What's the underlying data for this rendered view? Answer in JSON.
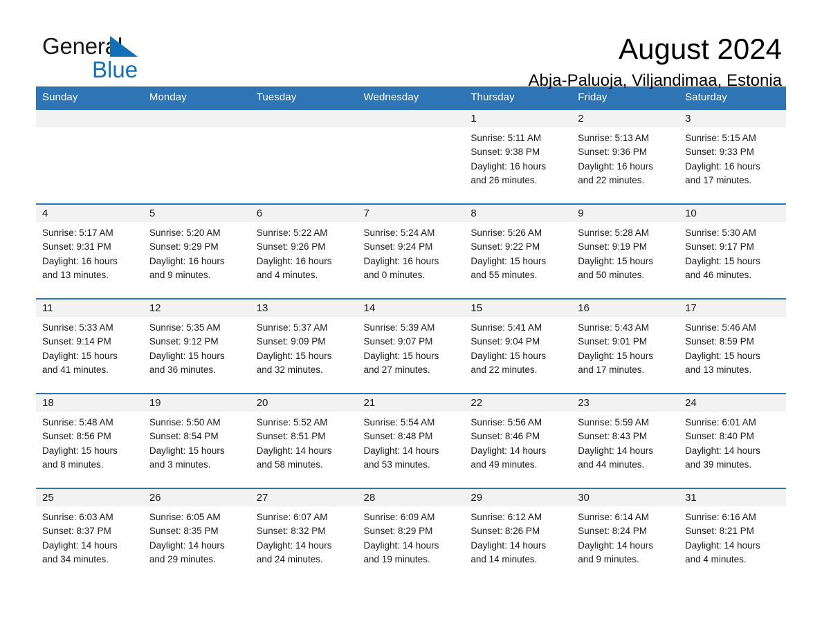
{
  "brand": {
    "name_part1": "General",
    "name_part2": "Blue",
    "logo_icon": "triangle-flag-icon",
    "accent_color": "#1170b8"
  },
  "header": {
    "title": "August 2024",
    "subtitle": "Abja-Paluoja, Viljandimaa, Estonia"
  },
  "theme": {
    "header_blue": "#2e75b6",
    "daynum_band": "#f2f2f2",
    "text": "#1a1a1a"
  },
  "calendar": {
    "month": "August",
    "year": "2024",
    "weekday_headers": [
      "Sunday",
      "Monday",
      "Tuesday",
      "Wednesday",
      "Thursday",
      "Friday",
      "Saturday"
    ],
    "weeks": [
      [
        {
          "day": "",
          "lines": []
        },
        {
          "day": "",
          "lines": []
        },
        {
          "day": "",
          "lines": []
        },
        {
          "day": "",
          "lines": []
        },
        {
          "day": "1",
          "lines": [
            "Sunrise: 5:11 AM",
            "Sunset: 9:38 PM",
            "Daylight: 16 hours",
            "and 26 minutes."
          ]
        },
        {
          "day": "2",
          "lines": [
            "Sunrise: 5:13 AM",
            "Sunset: 9:36 PM",
            "Daylight: 16 hours",
            "and 22 minutes."
          ]
        },
        {
          "day": "3",
          "lines": [
            "Sunrise: 5:15 AM",
            "Sunset: 9:33 PM",
            "Daylight: 16 hours",
            "and 17 minutes."
          ]
        }
      ],
      [
        {
          "day": "4",
          "lines": [
            "Sunrise: 5:17 AM",
            "Sunset: 9:31 PM",
            "Daylight: 16 hours",
            "and 13 minutes."
          ]
        },
        {
          "day": "5",
          "lines": [
            "Sunrise: 5:20 AM",
            "Sunset: 9:29 PM",
            "Daylight: 16 hours",
            "and 9 minutes."
          ]
        },
        {
          "day": "6",
          "lines": [
            "Sunrise: 5:22 AM",
            "Sunset: 9:26 PM",
            "Daylight: 16 hours",
            "and 4 minutes."
          ]
        },
        {
          "day": "7",
          "lines": [
            "Sunrise: 5:24 AM",
            "Sunset: 9:24 PM",
            "Daylight: 16 hours",
            "and 0 minutes."
          ]
        },
        {
          "day": "8",
          "lines": [
            "Sunrise: 5:26 AM",
            "Sunset: 9:22 PM",
            "Daylight: 15 hours",
            "and 55 minutes."
          ]
        },
        {
          "day": "9",
          "lines": [
            "Sunrise: 5:28 AM",
            "Sunset: 9:19 PM",
            "Daylight: 15 hours",
            "and 50 minutes."
          ]
        },
        {
          "day": "10",
          "lines": [
            "Sunrise: 5:30 AM",
            "Sunset: 9:17 PM",
            "Daylight: 15 hours",
            "and 46 minutes."
          ]
        }
      ],
      [
        {
          "day": "11",
          "lines": [
            "Sunrise: 5:33 AM",
            "Sunset: 9:14 PM",
            "Daylight: 15 hours",
            "and 41 minutes."
          ]
        },
        {
          "day": "12",
          "lines": [
            "Sunrise: 5:35 AM",
            "Sunset: 9:12 PM",
            "Daylight: 15 hours",
            "and 36 minutes."
          ]
        },
        {
          "day": "13",
          "lines": [
            "Sunrise: 5:37 AM",
            "Sunset: 9:09 PM",
            "Daylight: 15 hours",
            "and 32 minutes."
          ]
        },
        {
          "day": "14",
          "lines": [
            "Sunrise: 5:39 AM",
            "Sunset: 9:07 PM",
            "Daylight: 15 hours",
            "and 27 minutes."
          ]
        },
        {
          "day": "15",
          "lines": [
            "Sunrise: 5:41 AM",
            "Sunset: 9:04 PM",
            "Daylight: 15 hours",
            "and 22 minutes."
          ]
        },
        {
          "day": "16",
          "lines": [
            "Sunrise: 5:43 AM",
            "Sunset: 9:01 PM",
            "Daylight: 15 hours",
            "and 17 minutes."
          ]
        },
        {
          "day": "17",
          "lines": [
            "Sunrise: 5:46 AM",
            "Sunset: 8:59 PM",
            "Daylight: 15 hours",
            "and 13 minutes."
          ]
        }
      ],
      [
        {
          "day": "18",
          "lines": [
            "Sunrise: 5:48 AM",
            "Sunset: 8:56 PM",
            "Daylight: 15 hours",
            "and 8 minutes."
          ]
        },
        {
          "day": "19",
          "lines": [
            "Sunrise: 5:50 AM",
            "Sunset: 8:54 PM",
            "Daylight: 15 hours",
            "and 3 minutes."
          ]
        },
        {
          "day": "20",
          "lines": [
            "Sunrise: 5:52 AM",
            "Sunset: 8:51 PM",
            "Daylight: 14 hours",
            "and 58 minutes."
          ]
        },
        {
          "day": "21",
          "lines": [
            "Sunrise: 5:54 AM",
            "Sunset: 8:48 PM",
            "Daylight: 14 hours",
            "and 53 minutes."
          ]
        },
        {
          "day": "22",
          "lines": [
            "Sunrise: 5:56 AM",
            "Sunset: 8:46 PM",
            "Daylight: 14 hours",
            "and 49 minutes."
          ]
        },
        {
          "day": "23",
          "lines": [
            "Sunrise: 5:59 AM",
            "Sunset: 8:43 PM",
            "Daylight: 14 hours",
            "and 44 minutes."
          ]
        },
        {
          "day": "24",
          "lines": [
            "Sunrise: 6:01 AM",
            "Sunset: 8:40 PM",
            "Daylight: 14 hours",
            "and 39 minutes."
          ]
        }
      ],
      [
        {
          "day": "25",
          "lines": [
            "Sunrise: 6:03 AM",
            "Sunset: 8:37 PM",
            "Daylight: 14 hours",
            "and 34 minutes."
          ]
        },
        {
          "day": "26",
          "lines": [
            "Sunrise: 6:05 AM",
            "Sunset: 8:35 PM",
            "Daylight: 14 hours",
            "and 29 minutes."
          ]
        },
        {
          "day": "27",
          "lines": [
            "Sunrise: 6:07 AM",
            "Sunset: 8:32 PM",
            "Daylight: 14 hours",
            "and 24 minutes."
          ]
        },
        {
          "day": "28",
          "lines": [
            "Sunrise: 6:09 AM",
            "Sunset: 8:29 PM",
            "Daylight: 14 hours",
            "and 19 minutes."
          ]
        },
        {
          "day": "29",
          "lines": [
            "Sunrise: 6:12 AM",
            "Sunset: 8:26 PM",
            "Daylight: 14 hours",
            "and 14 minutes."
          ]
        },
        {
          "day": "30",
          "lines": [
            "Sunrise: 6:14 AM",
            "Sunset: 8:24 PM",
            "Daylight: 14 hours",
            "and 9 minutes."
          ]
        },
        {
          "day": "31",
          "lines": [
            "Sunrise: 6:16 AM",
            "Sunset: 8:21 PM",
            "Daylight: 14 hours",
            "and 4 minutes."
          ]
        }
      ]
    ]
  }
}
